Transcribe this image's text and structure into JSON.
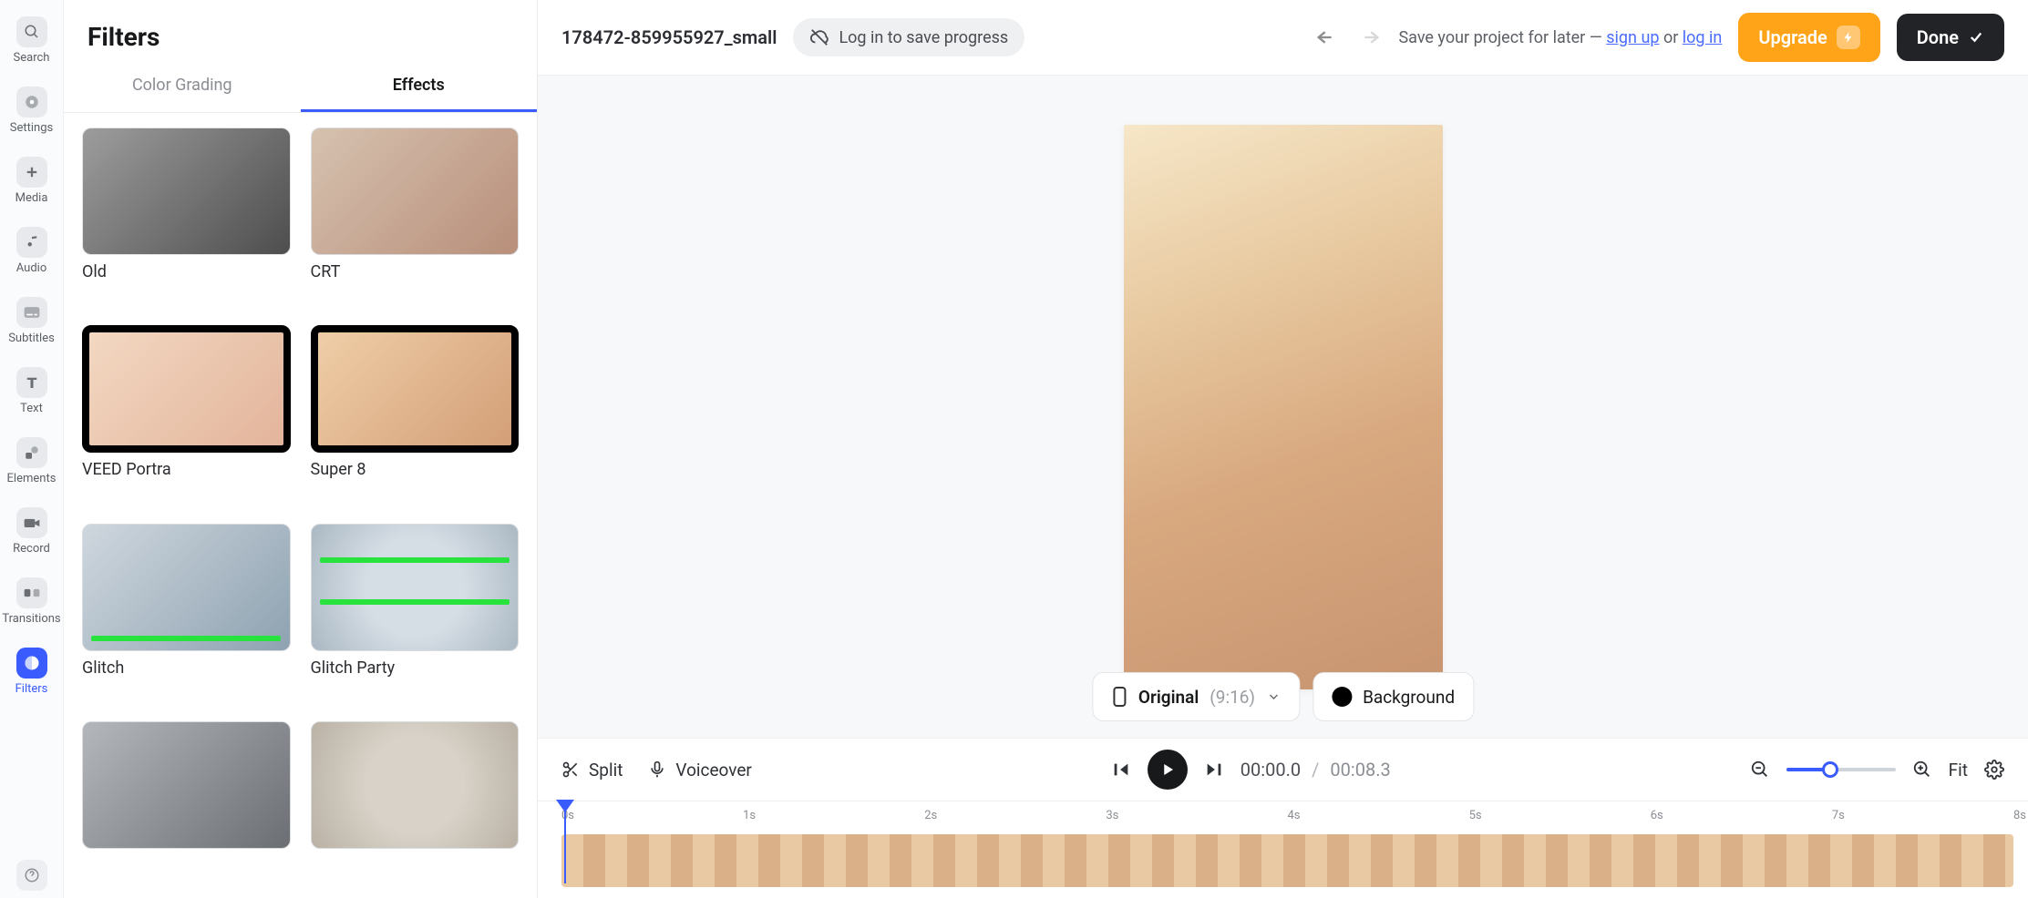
{
  "toolrail": [
    {
      "name": "search",
      "label": "Search",
      "icon": "search"
    },
    {
      "name": "settings",
      "label": "Settings",
      "icon": "gear"
    },
    {
      "name": "media",
      "label": "Media",
      "icon": "plus"
    },
    {
      "name": "audio",
      "label": "Audio",
      "icon": "note"
    },
    {
      "name": "subtitles",
      "label": "Subtitles",
      "icon": "subtitles"
    },
    {
      "name": "text",
      "label": "Text",
      "icon": "text"
    },
    {
      "name": "elements",
      "label": "Elements",
      "icon": "shapes"
    },
    {
      "name": "record",
      "label": "Record",
      "icon": "camera"
    },
    {
      "name": "transitions",
      "label": "Transitions",
      "icon": "transitions"
    },
    {
      "name": "filters",
      "label": "Filters",
      "icon": "filters",
      "active": true
    }
  ],
  "sidepanel": {
    "title": "Filters",
    "tabs": [
      {
        "id": "color-grading",
        "label": "Color Grading"
      },
      {
        "id": "effects",
        "label": "Effects",
        "active": true
      }
    ],
    "effects": [
      {
        "id": "old",
        "label": "Old",
        "cls": "old"
      },
      {
        "id": "crt",
        "label": "CRT",
        "cls": "crt"
      },
      {
        "id": "veed-portra",
        "label": "VEED Portra",
        "cls": "portra"
      },
      {
        "id": "super-8",
        "label": "Super 8",
        "cls": "super8"
      },
      {
        "id": "glitch",
        "label": "Glitch",
        "cls": "glitch"
      },
      {
        "id": "glitch-party",
        "label": "Glitch Party",
        "cls": "glitchparty"
      },
      {
        "id": "film",
        "label": "",
        "cls": "film"
      },
      {
        "id": "vhs",
        "label": "",
        "cls": "vhs"
      }
    ]
  },
  "topbar": {
    "project_name": "178472-859955927_small",
    "login_prompt": "Log in to save progress",
    "save_text_pre": "Save your project for later — ",
    "signup": "sign up",
    "or": " or ",
    "login": "log in",
    "upgrade_label": "Upgrade",
    "done_label": "Done"
  },
  "canvas": {
    "aspect": {
      "label": "Original",
      "ratio": "(9:16)"
    },
    "background_label": "Background"
  },
  "controls": {
    "split": "Split",
    "voiceover": "Voiceover",
    "current_time": "00:00.0",
    "total_time": "00:08.3",
    "fit": "Fit"
  },
  "timeline": {
    "ticks": [
      "0s",
      "1s",
      "2s",
      "3s",
      "4s",
      "5s",
      "6s",
      "7s",
      "8s"
    ],
    "playhead_seconds": 0
  }
}
